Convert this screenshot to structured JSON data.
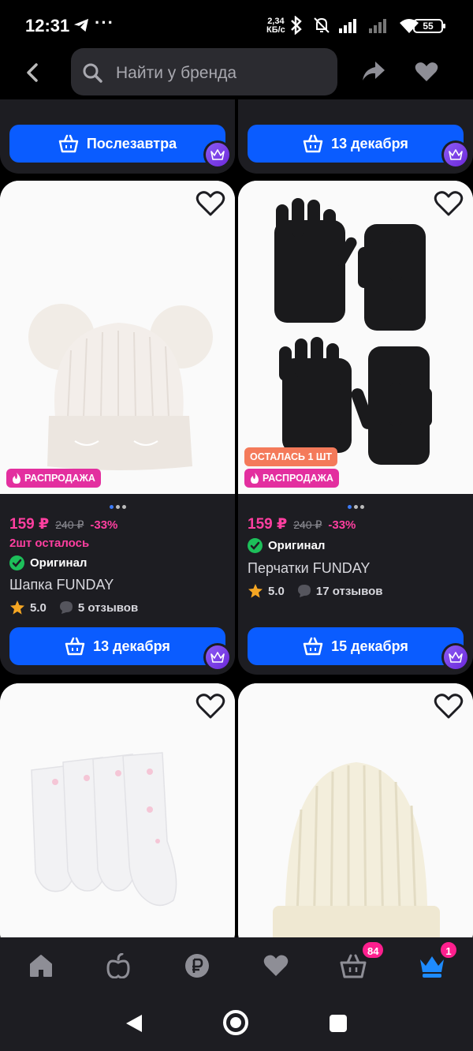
{
  "status_bar": {
    "time": "12:31",
    "speed_value": "2,34",
    "speed_unit": "КБ/с",
    "battery": "55"
  },
  "header": {
    "search_placeholder": "Найти у бренда"
  },
  "top_cards": [
    {
      "delivery": "Послезавтра"
    },
    {
      "delivery": "13 декабря"
    }
  ],
  "products": [
    {
      "badge_sale": "РАСПРОДАЖА",
      "price": "159 ₽",
      "old_price": "240 ₽",
      "discount": "-33%",
      "stock": "2шт осталось",
      "original": "Оригинал",
      "title": "Шапка FUNDAY",
      "rating": "5.0",
      "reviews": "5 отзывов",
      "delivery": "13 декабря"
    },
    {
      "badge_left": "ОСТАЛАСЬ 1 ШТ",
      "badge_sale": "РАСПРОДАЖА",
      "price": "159 ₽",
      "old_price": "240 ₽",
      "discount": "-33%",
      "original": "Оригинал",
      "title": "Перчатки FUNDAY",
      "rating": "5.0",
      "reviews": "17 отзывов",
      "delivery": "15 декабря"
    }
  ],
  "tabbar": {
    "items": [
      "home-icon",
      "apple-icon",
      "ruble-icon",
      "heart-icon",
      "cart-icon",
      "crown-icon"
    ],
    "cart_badge": "84",
    "profile_badge": "1"
  },
  "colors": {
    "accent_blue": "#0a5cff",
    "pink": "#ff3fa0",
    "card_bg": "#1d1d22"
  }
}
